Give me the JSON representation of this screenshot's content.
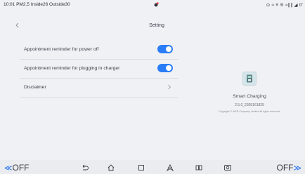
{
  "status_bar": {
    "left_text": "10:01 PM2.5 Inside26 Outside30",
    "right_text": "⊙ ≈ ≡ ≋ ≈∥∥ ◢ 0'"
  },
  "header": {
    "title": "Setting"
  },
  "settings": {
    "items": [
      {
        "label": "Appointment reminder for power off",
        "control": "toggle",
        "on": true
      },
      {
        "label": "Appointment reminder for plugging in charger",
        "control": "toggle",
        "on": true
      },
      {
        "label": "Disclaimer",
        "control": "chevron"
      }
    ]
  },
  "about": {
    "app_name": "Smart Charging",
    "version": "2.5.0_2305161825",
    "copyright": "Copyright © WED Company Limited All rights reserved."
  },
  "nav_bar": {
    "left_label": "OFF",
    "right_label": "OFF",
    "icons": [
      "back-icon",
      "home-icon",
      "recents-icon",
      "navigation-icon",
      "split-screen-icon",
      "camera-icon"
    ]
  },
  "colors": {
    "accent": "#2a7df6",
    "background": "#f0f1f4"
  }
}
